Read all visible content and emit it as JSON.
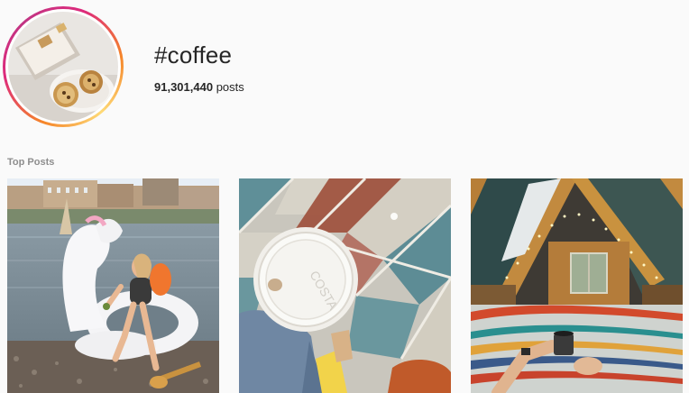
{
  "hashtag": {
    "title": "#coffee",
    "post_count": "91,301,440",
    "post_count_suffix": "posts"
  },
  "top_posts": {
    "label": "Top Posts",
    "items": [
      {
        "subject": "woman-on-unicorn-float-by-river"
      },
      {
        "subject": "coffee-cup-lid-on-tiled-floor"
      },
      {
        "subject": "attic-bed-with-mug"
      }
    ]
  },
  "colors": {
    "accent_gradient_start": "#f58529",
    "accent_gradient_mid": "#dd2a7b",
    "label_gray": "#8e8e8e",
    "background": "#fafafa"
  }
}
